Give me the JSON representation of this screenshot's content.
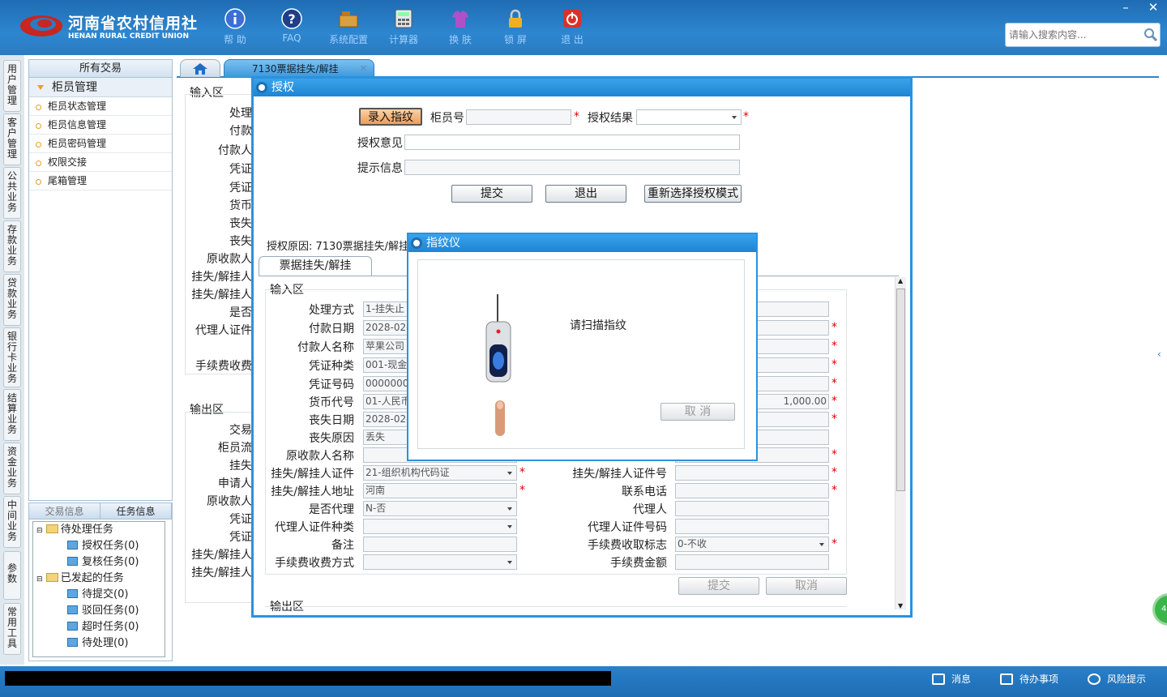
{
  "header": {
    "logo_cn": "河南省农村信用社",
    "logo_en": "HENAN RURAL CREDIT UNION",
    "toolbar": [
      {
        "label": "帮 助",
        "icon": "info-icon"
      },
      {
        "label": "FAQ",
        "icon": "question-icon"
      },
      {
        "label": "系统配置",
        "icon": "config-icon"
      },
      {
        "label": "计算器",
        "icon": "calculator-icon"
      },
      {
        "label": "换 肤",
        "icon": "skin-icon"
      },
      {
        "label": "锁 屏",
        "icon": "lock-icon"
      },
      {
        "label": "退 出",
        "icon": "power-icon"
      }
    ],
    "search_placeholder": "请输入搜索内容...",
    "min": "–",
    "close": "✕"
  },
  "left_nav": [
    "用户管理",
    "客户管理",
    "公共业务",
    "存款业务",
    "贷款业务",
    "银行卡业务",
    "结算业务",
    "资金业务",
    "中间业务",
    "参数",
    "常用工具"
  ],
  "sidebar": {
    "title": "所有交易",
    "group": "柜员管理",
    "items": [
      "柜员状态管理",
      "柜员信息管理",
      "柜员密码管理",
      "权限交接",
      "尾箱管理"
    ]
  },
  "task_panel": {
    "tabs": [
      "交易信息",
      "任务信息"
    ],
    "pending": "待处理任务",
    "pending_items": [
      "授权任务(0)",
      "复核任务(0)"
    ],
    "initiated": "已发起的任务",
    "initiated_items": [
      "待提交(0)",
      "驳回任务(0)",
      "超时任务(0)",
      "待处理(0)"
    ]
  },
  "tabs": {
    "active": "7130票据挂失/解挂"
  },
  "bg_form": {
    "input_title": "输入区",
    "input_labels": [
      "处理",
      "付款",
      "付款人",
      "凭证",
      "凭证",
      "货币",
      "丧失",
      "丧失",
      "原收款人",
      "挂失/解挂人",
      "挂失/解挂人",
      "是否",
      "代理人证件",
      "手续费收费"
    ],
    "output_title": "输出区",
    "output_labels": [
      "交易",
      "柜员流",
      "挂失",
      "申请人",
      "原收款人",
      "凭证",
      "凭证",
      "挂失/解挂人",
      "挂失/解挂人"
    ]
  },
  "auth": {
    "title": "授权",
    "btn_fingerprint": "录入指纹",
    "teller_label": "柜员号",
    "result_label": "授权结果",
    "opinion_label": "授权意见",
    "hint_label": "提示信息",
    "submit": "提交",
    "exit": "退出",
    "reselect": "重新选择授权模式",
    "reason": "授权原因: 7130票据挂失/解挂",
    "subtab": "票据挂失/解挂",
    "input_title": "输入区",
    "left_fields": [
      {
        "label": "处理方式",
        "value": "1-挂失止"
      },
      {
        "label": "付款日期",
        "value": "2028-02-"
      },
      {
        "label": "付款人名称",
        "value": "苹果公司"
      },
      {
        "label": "凭证种类",
        "value": "001-现金"
      },
      {
        "label": "凭证号码",
        "value": "0000000"
      },
      {
        "label": "货币代号",
        "value": "01-人民币"
      },
      {
        "label": "丧失日期",
        "value": "2028-02-"
      },
      {
        "label": "丧失原因",
        "value": "丢失"
      },
      {
        "label": "原收款人名称",
        "value": ""
      }
    ],
    "right_amount": "1,000.00",
    "id_type_label": "挂失/解挂人证件",
    "id_type_value": "21-组织机构代码证",
    "id_no_label": "挂失/解挂人证件号",
    "addr_label": "挂失/解挂人地址",
    "addr_value": "河南",
    "phone_label": "联系电话",
    "agent_flag_label": "是否代理",
    "agent_flag_value": "N-否",
    "agent_label": "代理人",
    "agent_id_type_label": "代理人证件种类",
    "agent_id_no_label": "代理人证件号码",
    "remark_label": "备注",
    "fee_flag_label": "手续费收取标志",
    "fee_flag_value": "0-不收",
    "fee_mode_label": "手续费收费方式",
    "fee_amount_label": "手续费金额",
    "inner_submit": "提交",
    "inner_cancel": "取消",
    "output_title": "输出区"
  },
  "fingerprint": {
    "title": "指纹仪",
    "prompt": "请扫描指纹",
    "cancel": "取 消"
  },
  "statusbar": {
    "msg": "消息",
    "todo": "待办事项",
    "risk": "风险提示"
  },
  "colors": {
    "accent": "#2a92de",
    "required": "#dd0000",
    "highlight_btn": "#f0a060"
  }
}
